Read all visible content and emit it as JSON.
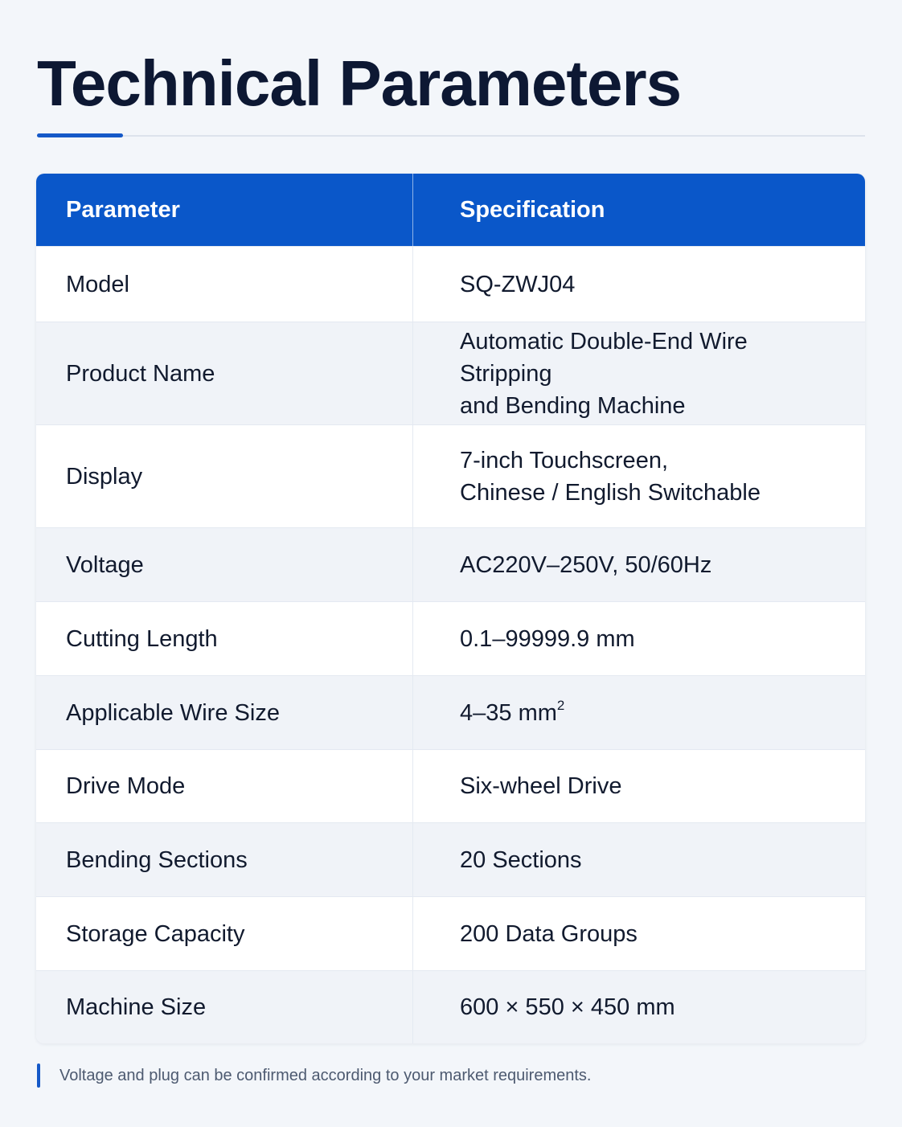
{
  "page": {
    "title": "Technical Parameters",
    "accent_color": "#1559c8",
    "header_color": "#0a57c9"
  },
  "table": {
    "headers": {
      "parameter": "Parameter",
      "specification": "Specification"
    },
    "rows": [
      {
        "parameter": "Model",
        "lines": [
          "SQ-ZWJ04"
        ]
      },
      {
        "parameter": "Product Name",
        "lines": [
          "Automatic Double-End Wire Stripping",
          "and Bending Machine"
        ]
      },
      {
        "parameter": "Display",
        "lines": [
          "7-inch Touchscreen,",
          "Chinese / English Switchable"
        ]
      },
      {
        "parameter": "Voltage",
        "lines": [
          "AC220V–250V, 50/60Hz"
        ]
      },
      {
        "parameter": "Cutting Length",
        "lines": [
          "0.1–99999.9 mm"
        ]
      },
      {
        "parameter": "Applicable Wire Size",
        "lines": [
          "4–35 mm"
        ],
        "superscript": "2"
      },
      {
        "parameter": "Drive Mode",
        "lines": [
          "Six-wheel Drive"
        ]
      },
      {
        "parameter": "Bending Sections",
        "lines": [
          "20 Sections"
        ]
      },
      {
        "parameter": "Storage Capacity",
        "lines": [
          "200 Data Groups"
        ]
      },
      {
        "parameter": "Machine Size",
        "lines": [
          "600 × 550 × 450 mm"
        ]
      }
    ]
  },
  "footnote": {
    "text": "Voltage and plug can be confirmed according to your market requirements."
  }
}
